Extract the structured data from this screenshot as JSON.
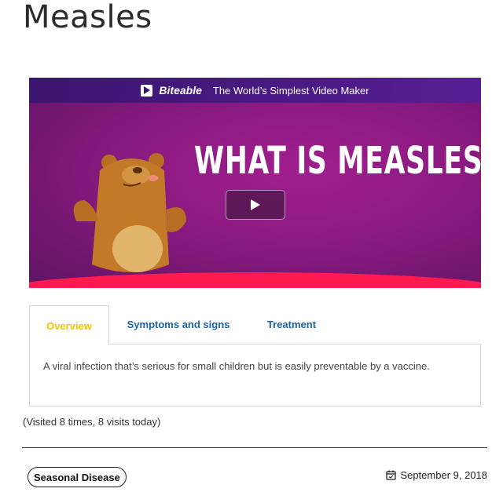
{
  "page": {
    "title": "Measles"
  },
  "video": {
    "banner_brand": "Biteable",
    "banner_tagline": "The World’s Simplest Video Maker",
    "headline": "WHAT IS MEASLES?",
    "play_icon": "play-icon"
  },
  "tabs": {
    "items": [
      {
        "label": "Overview",
        "active": true
      },
      {
        "label": "Symptoms and signs",
        "active": false
      },
      {
        "label": "Treatment",
        "active": false
      }
    ],
    "content": "A viral infection that’s serious for small children but is easily preventable by a vaccine."
  },
  "meta": {
    "visits": "(Visited 8 times, 8 visits today)",
    "category": "Seasonal Disease",
    "date": "September 9, 2018",
    "date_icon": "calendar-check-icon"
  },
  "colors": {
    "active_tab": "#f2c500",
    "tab_link": "#1d62a8",
    "video_bg": "#8a1a80",
    "floor": "#ff1a4f"
  }
}
